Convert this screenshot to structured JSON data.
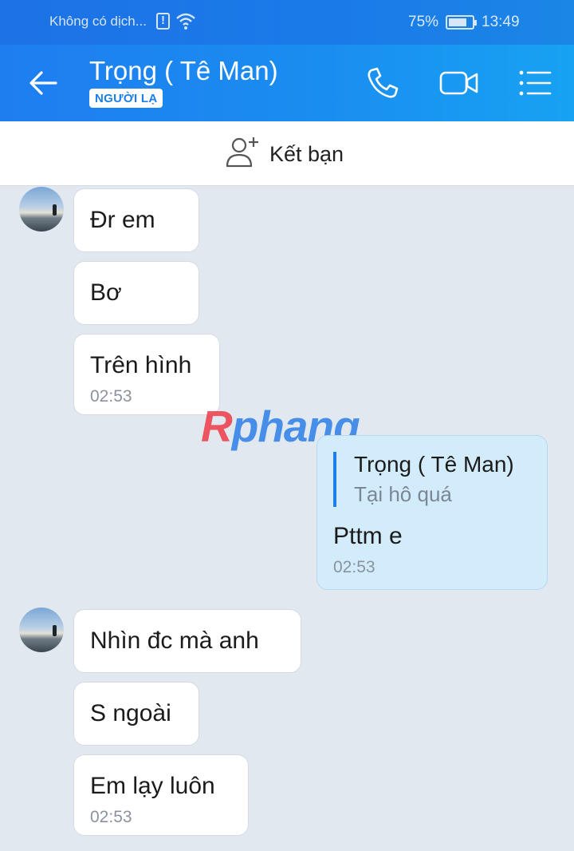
{
  "status_bar": {
    "carrier": "Không có dịch...",
    "battery": "75%",
    "time": "13:49"
  },
  "header": {
    "title": "Trọng ( Tê Man)",
    "badge": "NGƯỜI LẠ",
    "icons": [
      "back-arrow-icon",
      "phone-icon",
      "video-call-icon",
      "menu-list-icon"
    ]
  },
  "friend_bar": {
    "label": "Kết bạn",
    "icon": "add-friend-icon"
  },
  "watermark": {
    "part1": "R",
    "part2": "phang"
  },
  "messages": {
    "group1": [
      {
        "text": "Đr em"
      },
      {
        "text": "Bơ"
      },
      {
        "text": "Trên hình",
        "time": "02:53"
      }
    ],
    "sent": {
      "quote_author": "Trọng ( Tê Man)",
      "quote_text": "Tại hô quá",
      "text": "Pttm e",
      "time": "02:53"
    },
    "group2": [
      {
        "text": "Nhìn đc mà anh"
      },
      {
        "text": "S ngoài"
      },
      {
        "text": "Em lạy luôn",
        "time": "02:53"
      }
    ]
  },
  "colors": {
    "header_blue": "#1a8df0",
    "sent_bubble": "#d3ecfc",
    "chat_background": "#e2e8ef"
  }
}
